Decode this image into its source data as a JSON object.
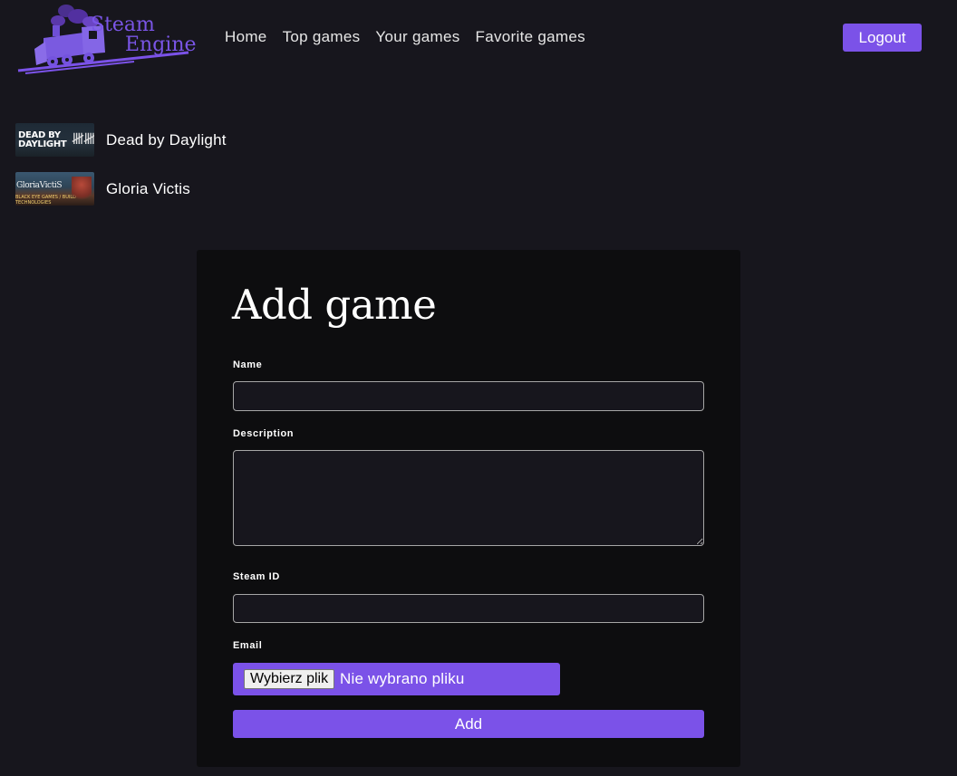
{
  "app": {
    "logo_line1": "Steam",
    "logo_line2": "Engine",
    "accent_color": "#7b52e8",
    "background_color": "#17161d"
  },
  "nav": {
    "items": [
      {
        "label": "Home"
      },
      {
        "label": "Top games"
      },
      {
        "label": "Your games"
      },
      {
        "label": "Favorite games"
      }
    ],
    "logout_label": "Logout"
  },
  "games": [
    {
      "title": "Dead by Daylight",
      "thumb_line1": "DEAD BY",
      "thumb_line2": "DAYLIGHT",
      "thumb_mark": "𝍸𝍸"
    },
    {
      "title": "Gloria Victis",
      "thumb_line1": "GloriaVictiS",
      "thumb_line2": "BLACK EYE GAMES / BUILD TECHNOLOGIES"
    }
  ],
  "form": {
    "title": "Add game",
    "name_label": "Name",
    "name_value": "",
    "description_label": "Description",
    "description_value": "",
    "steam_id_label": "Steam ID",
    "steam_id_value": "",
    "email_label": "Email",
    "file_button_label": "Wybierz plik",
    "file_status": "Nie wybrano pliku",
    "submit_label": "Add"
  }
}
